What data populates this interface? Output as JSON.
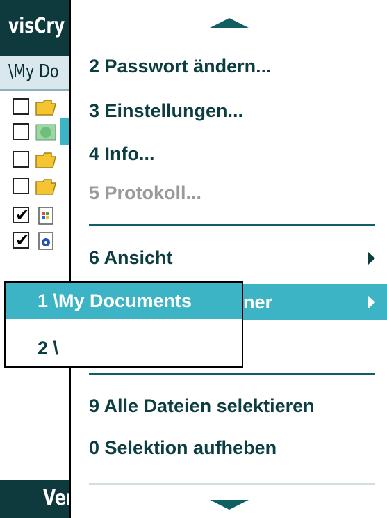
{
  "app": {
    "title": "visCry",
    "path": "\\My Do",
    "softkey_left": "Ver"
  },
  "files": [
    {
      "checked": false,
      "icon": "folder-icon"
    },
    {
      "checked": false,
      "icon": "network-folder-icon"
    },
    {
      "checked": false,
      "icon": "folder-icon"
    },
    {
      "checked": false,
      "icon": "folder-icon"
    },
    {
      "checked": true,
      "icon": "document-icon"
    },
    {
      "checked": true,
      "icon": "media-file-icon"
    }
  ],
  "menu": {
    "items": [
      {
        "label": "2 Passwort ändern...",
        "enabled": true
      },
      {
        "label": "3 Einstellungen...",
        "enabled": true
      },
      {
        "label": "4 Info...",
        "enabled": true
      },
      {
        "label": "5 Protokoll...",
        "enabled": false
      },
      {
        "label": "6 Ansicht",
        "enabled": true,
        "submenu": true
      },
      {
        "label": "ner",
        "enabled": true,
        "submenu": true,
        "selected": true
      },
      {
        "label": "9 Alle Dateien selektieren",
        "enabled": true
      },
      {
        "label": "0 Selektion aufheben",
        "enabled": true
      }
    ]
  },
  "submenu": {
    "items": [
      {
        "label": "1 \\My Documents",
        "selected": true
      },
      {
        "label": "2 \\",
        "selected": false
      }
    ]
  },
  "colors": {
    "accent": "#3cb4c5",
    "menu_text": "#0c3d40",
    "titlebar": "#0e3a3e",
    "disabled": "#9a9a9a"
  }
}
